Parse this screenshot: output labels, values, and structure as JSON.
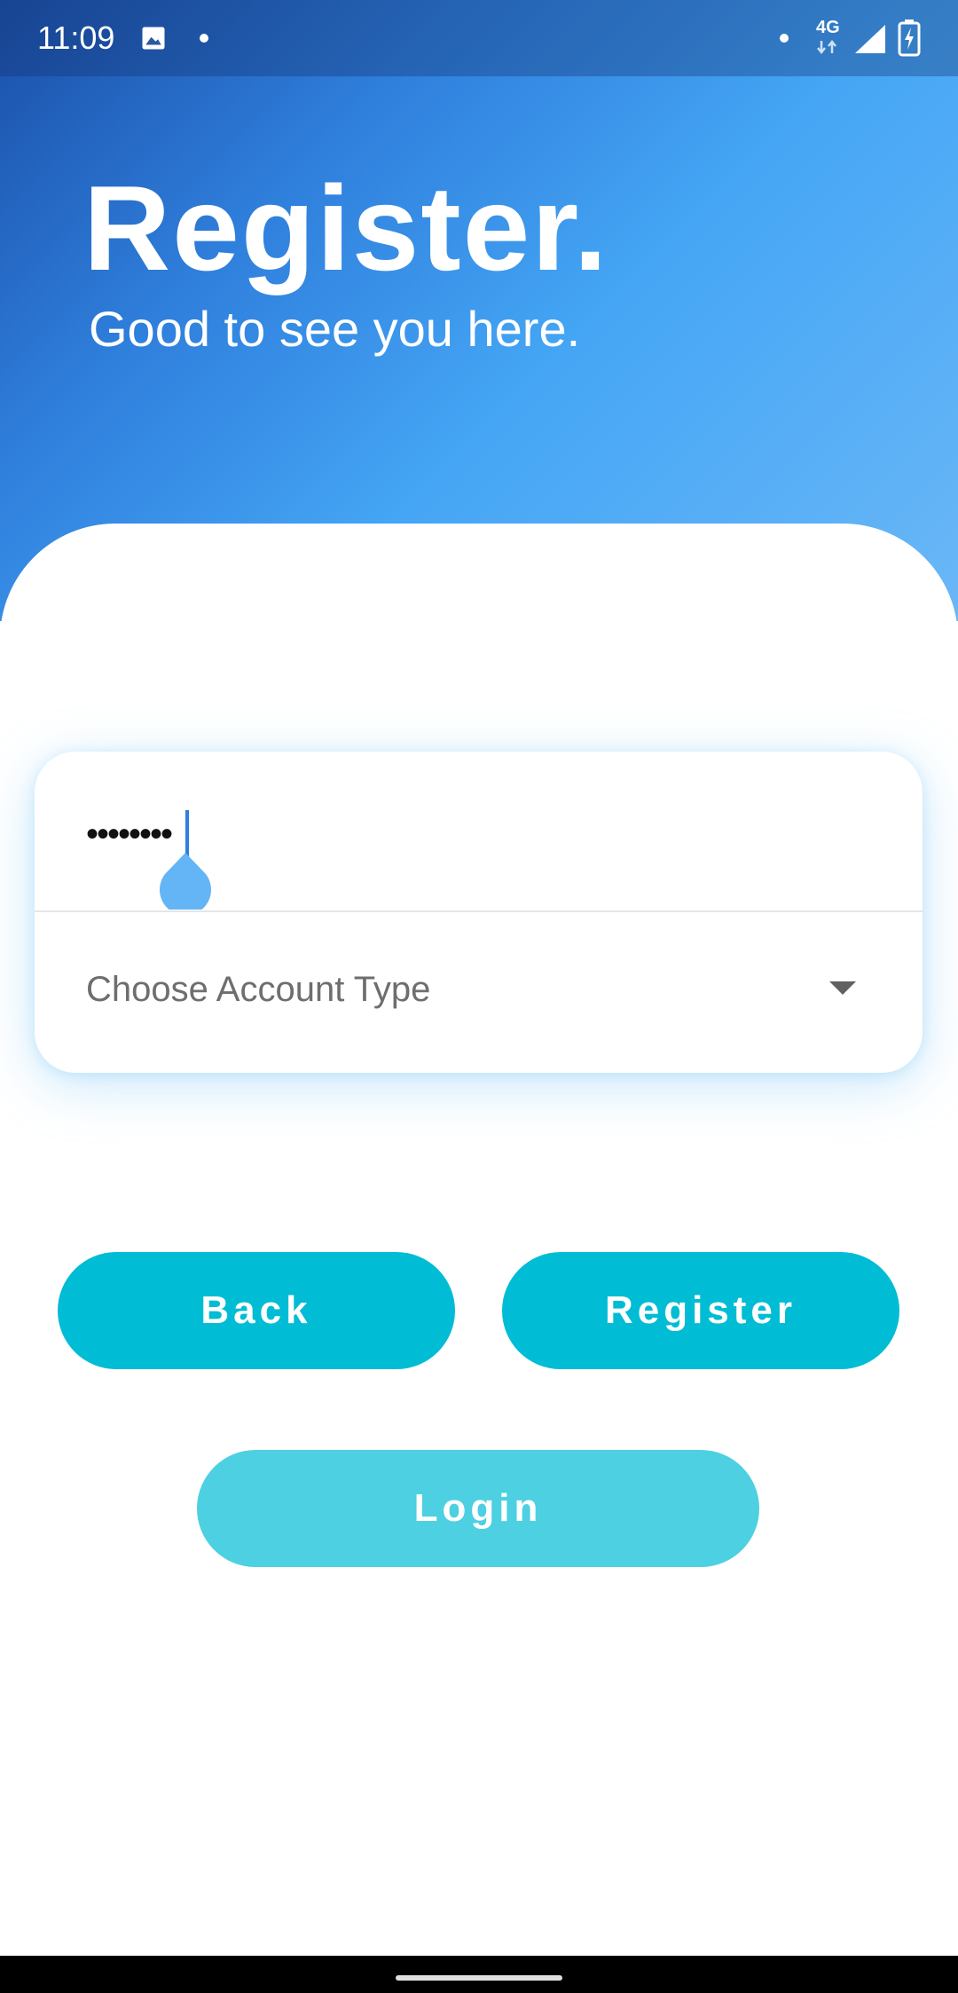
{
  "status_bar": {
    "time": "11:09",
    "network_label": "4G"
  },
  "header": {
    "title": "Register.",
    "subtitle": "Good to see you here."
  },
  "form": {
    "password_value": "••••••••",
    "account_type_placeholder": "Choose Account Type"
  },
  "buttons": {
    "back_label": "Back",
    "register_label": "Register",
    "login_label": "Login"
  },
  "colors": {
    "header_gradient": [
      "#1a4fa8",
      "#2f7fdc",
      "#45a6f5",
      "#6ab7f7"
    ],
    "primary_button": "#00bcd4",
    "secondary_button": "#4dd0e1",
    "cursor": "#2f7fdc",
    "cursor_handle": "#64b5f6"
  }
}
